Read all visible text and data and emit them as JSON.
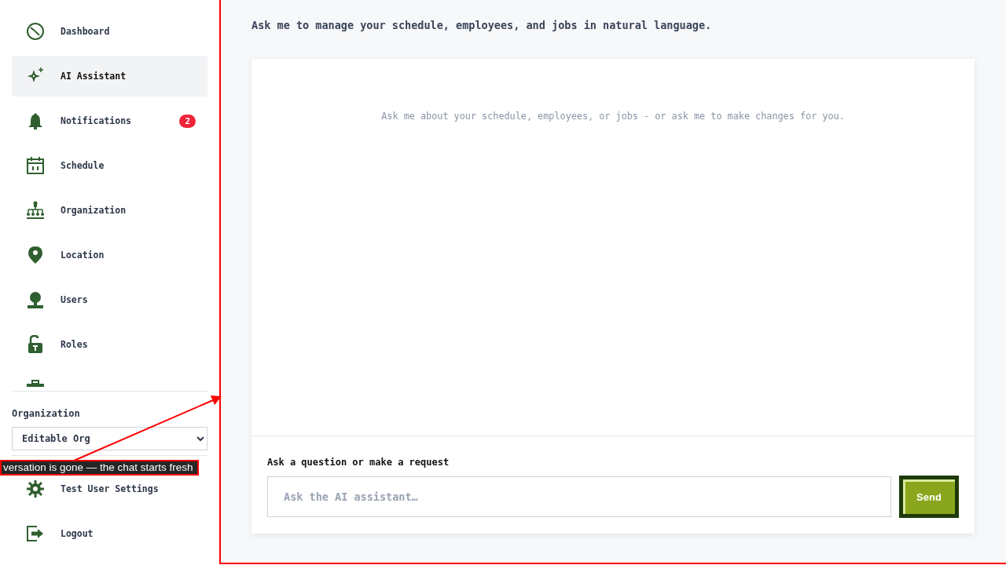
{
  "sidebar": {
    "items": [
      {
        "label": "Dashboard",
        "selected": false
      },
      {
        "label": "AI Assistant",
        "selected": true
      },
      {
        "label": "Notifications",
        "selected": false,
        "badge": "2"
      },
      {
        "label": "Schedule",
        "selected": false
      },
      {
        "label": "Organization",
        "selected": false
      },
      {
        "label": "Location",
        "selected": false
      },
      {
        "label": "Users",
        "selected": false
      },
      {
        "label": "Roles",
        "selected": false
      },
      {
        "selected": false
      }
    ],
    "org_label": "Organization",
    "org_select": "Editable Org",
    "footer_items": [
      {
        "label": "Test User Settings"
      },
      {
        "label": "Logout"
      }
    ]
  },
  "main": {
    "intro": "Ask me to manage your schedule, employees, and jobs in natural language.",
    "empty_message": "Ask me about your schedule, employees, or jobs - or ask me to make changes for you.",
    "input_label": "Ask a question or make a request",
    "placeholder": "Ask the AI assistant…",
    "send": "Send"
  },
  "annotation": {
    "text": "versation is gone — the chat starts fresh"
  }
}
